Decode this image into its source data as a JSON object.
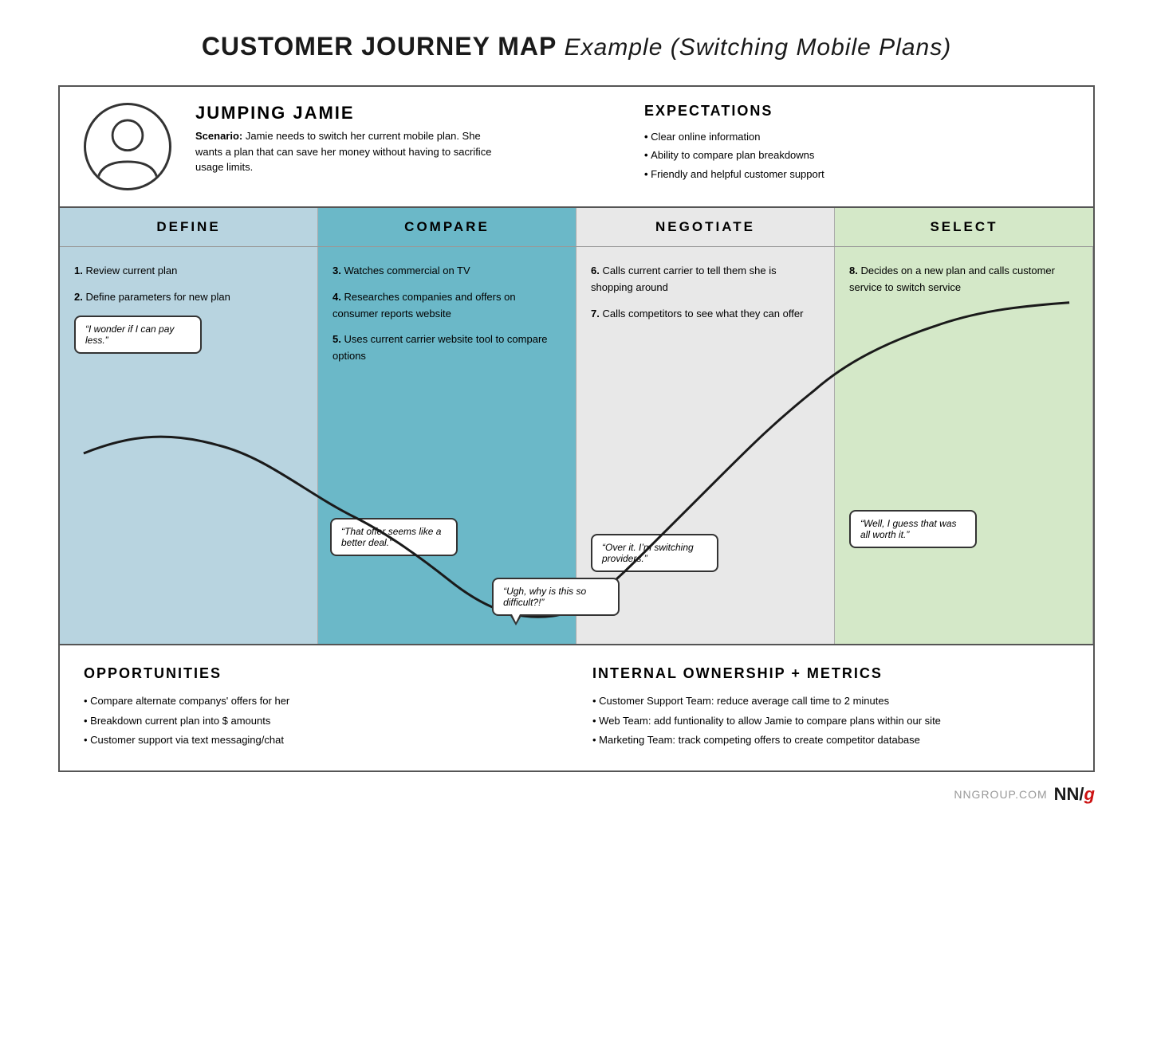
{
  "title": {
    "main": "CUSTOMER JOURNEY MAP",
    "sub": " Example (Switching Mobile Plans)"
  },
  "persona": {
    "name": "JUMPING JAMIE",
    "scenario_label": "Scenario:",
    "scenario_text": "Jamie needs to switch her current mobile plan. She wants a plan that can save her money without having to sacrifice usage limits.",
    "expectations_title": "EXPECTATIONS",
    "expectations": [
      "Clear online information",
      "Ability to compare plan breakdowns",
      "Friendly and helpful customer support"
    ]
  },
  "phases": [
    {
      "id": "define",
      "label": "DEFINE"
    },
    {
      "id": "compare",
      "label": "COMPARE"
    },
    {
      "id": "negotiate",
      "label": "NEGOTIATE"
    },
    {
      "id": "select",
      "label": "SELECT"
    }
  ],
  "steps": {
    "define": [
      "1. Review current plan",
      "2. Define parameters for new plan"
    ],
    "define_bubble": "“I wonder if I can pay less.”",
    "compare": [
      "3. Watches commercial on TV",
      "4. Researches companies and offers on consumer reports website",
      "5. Uses current carrier website tool to compare options"
    ],
    "compare_bubble1": "“That offer seems like a better deal.”",
    "compare_bubble2": "“Ugh, why is this so difficult?!”",
    "negotiate": [
      "6. Calls current carrier to tell them she is shopping around",
      "7. Calls competitors to see what they can offer"
    ],
    "negotiate_bubble": "“Over it. I’m switching providers.”",
    "select": [
      "8. Decides on a new plan and calls customer service to switch service"
    ],
    "select_bubble": "“Well, I guess that was all worth it.”"
  },
  "opportunities": {
    "title": "OPPORTUNITIES",
    "items": [
      "Compare alternate companys’ offers for her",
      "Breakdown current plan into $ amounts",
      "Customer support via text messaging/chat"
    ]
  },
  "metrics": {
    "title": "INTERNAL OWNERSHIP + METRICS",
    "items": [
      "Customer Support Team: reduce average call time to 2 minutes",
      "Web Team: add funtionality to allow Jamie to compare plans within our site",
      "Marketing Team: track competing offers to create competitor database"
    ]
  },
  "branding": {
    "url": "NNGROUP.COM",
    "logo_nn": "NN",
    "logo_slash": "/",
    "logo_g": "g"
  }
}
